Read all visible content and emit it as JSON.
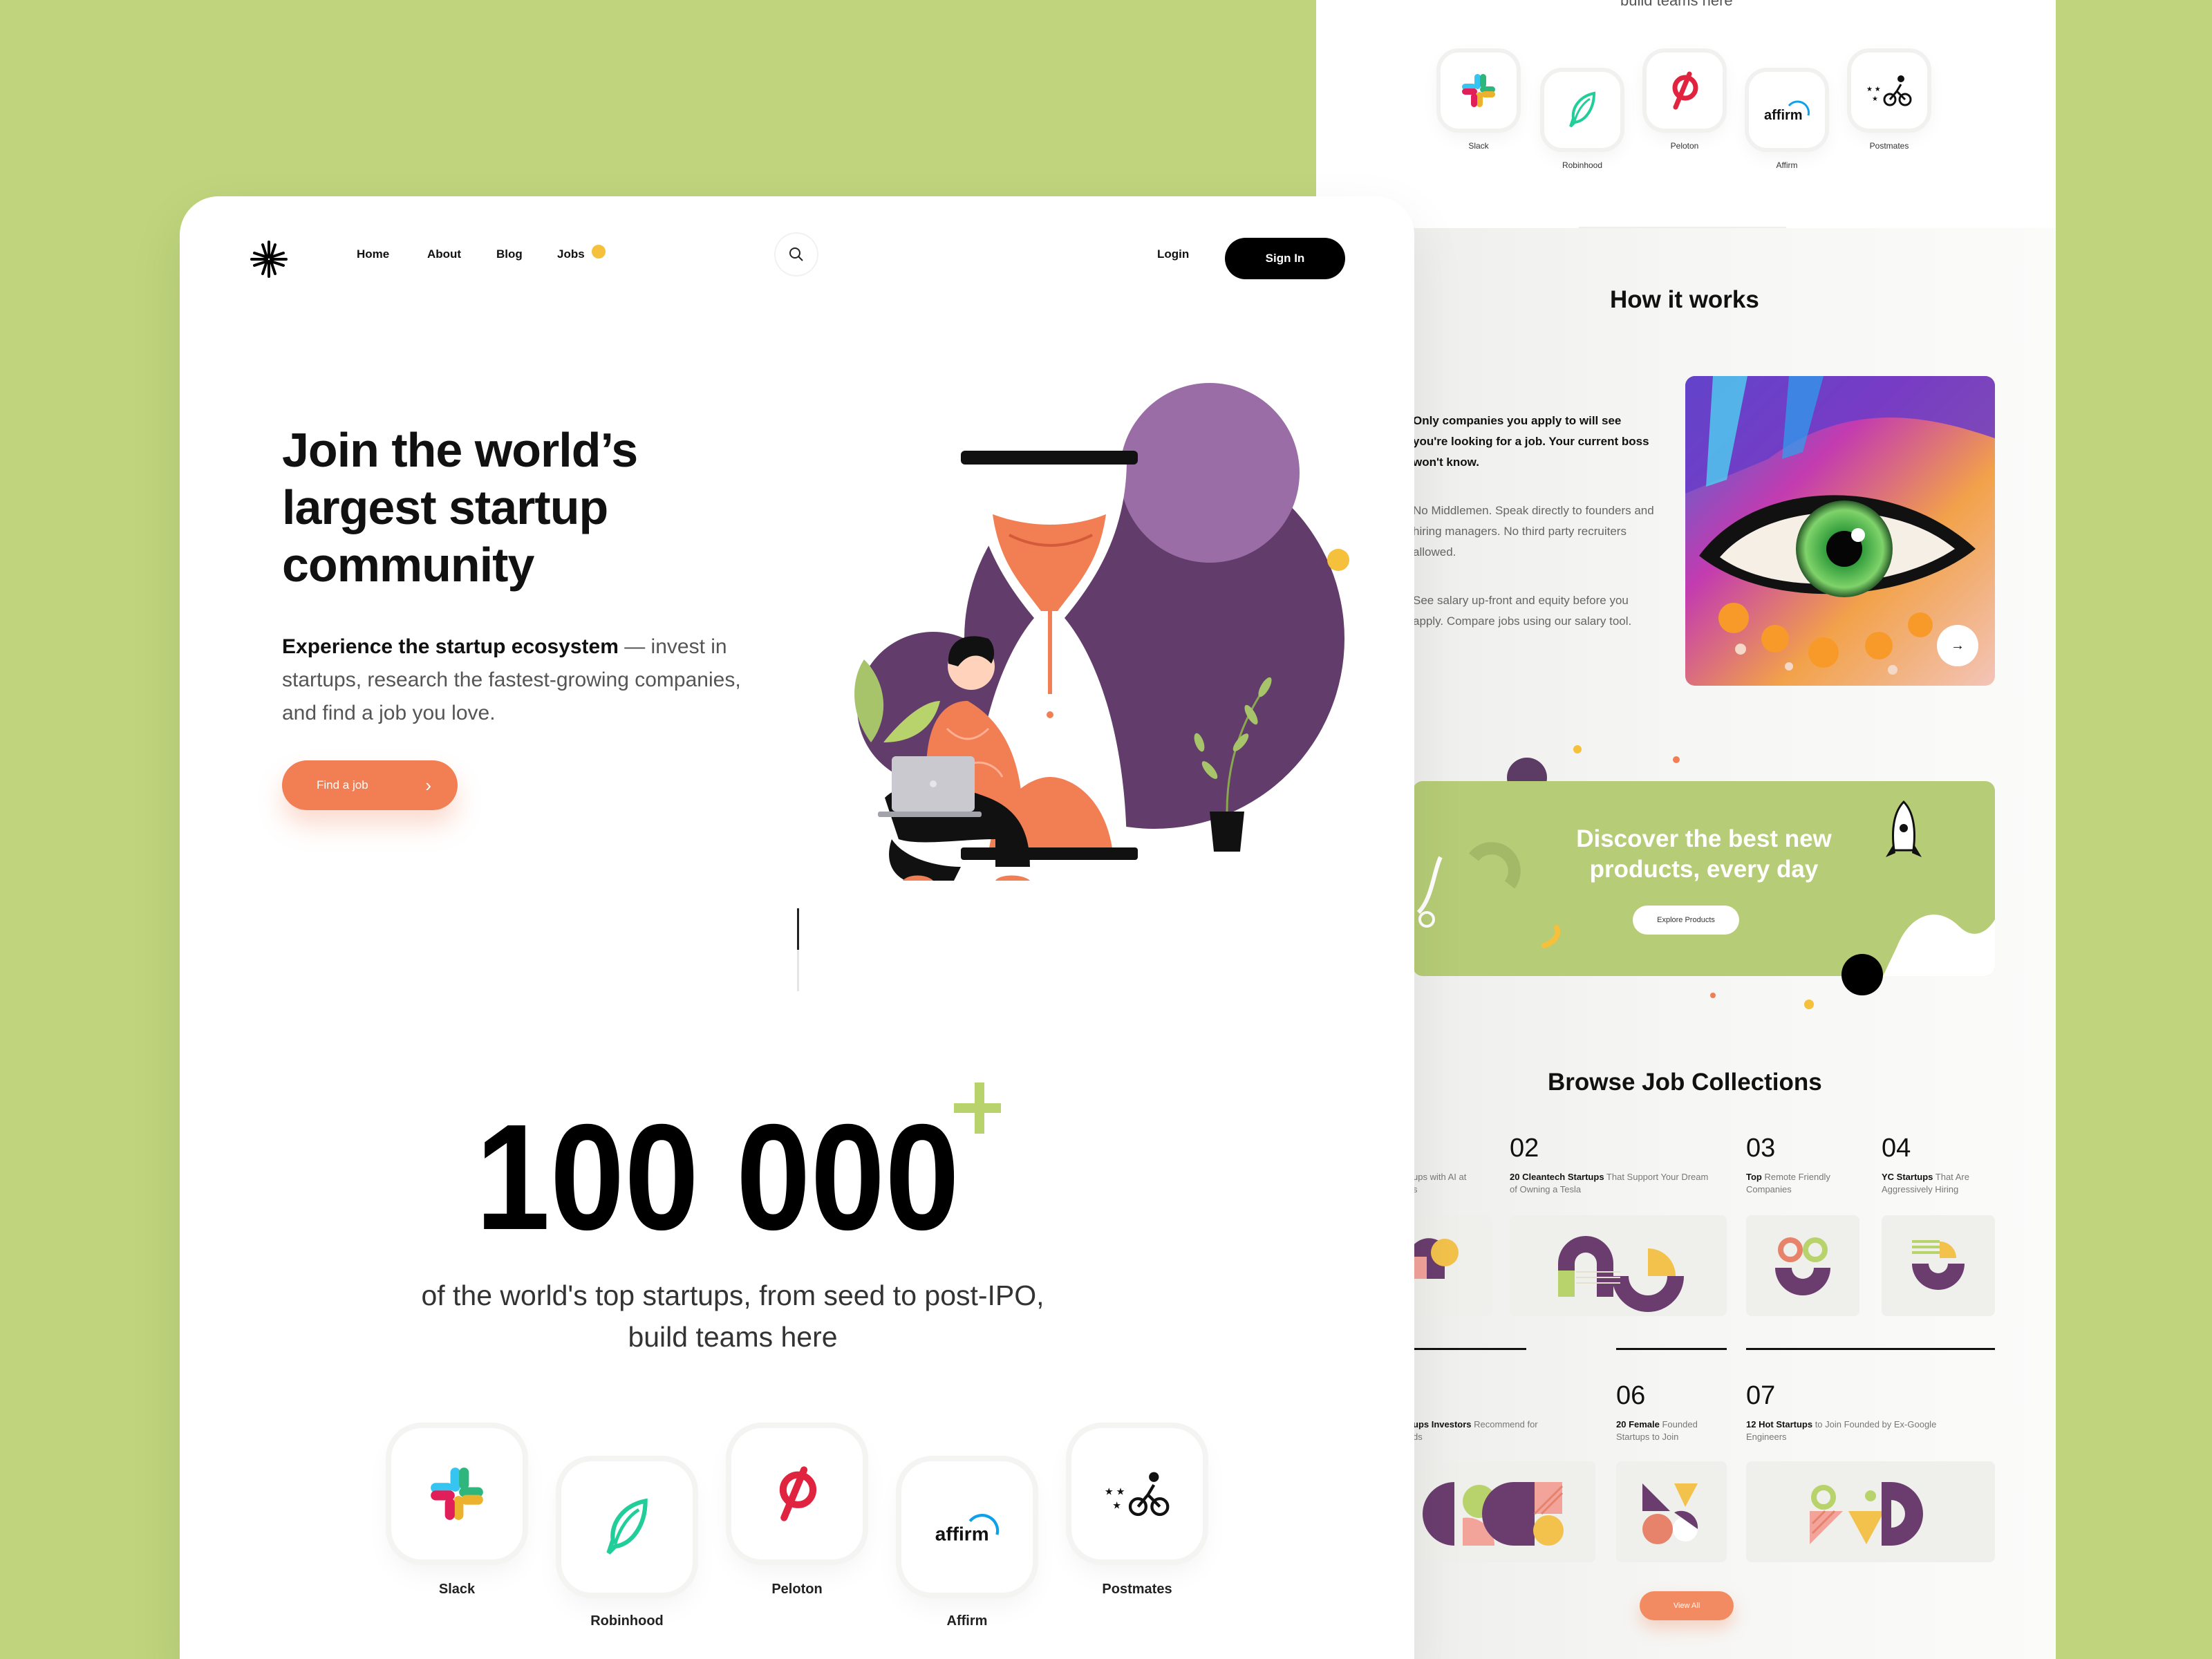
{
  "colors": {
    "background": "#bfd47c",
    "accent": "#f27e54",
    "purple": "#623c6a",
    "light_purple": "#9b6da6",
    "yellow": "#f5c03c",
    "black": "#000000"
  },
  "front": {
    "nav": {
      "logo": "logo-mark",
      "links": [
        "Home",
        "About",
        "Blog",
        "Jobs"
      ],
      "login": "Login",
      "signin": "Sign In"
    },
    "hero": {
      "title_lines": [
        "Join the world’s",
        "largest startup",
        "community"
      ],
      "desc_bold": "Experience the startup ecosystem",
      "desc_rest": " — invest in startups, research the fastest-growing companies, and find a job you love.",
      "cta": "Find a job"
    },
    "stats": {
      "number": "100 000",
      "plus": "+",
      "caption_line1": "of the world's top startups, from seed to post-IPO,",
      "caption_line2": "build teams here"
    },
    "companies": [
      {
        "name": "Slack",
        "icon": "slack-icon"
      },
      {
        "name": "Robinhood",
        "icon": "robinhood-icon"
      },
      {
        "name": "Peloton",
        "icon": "peloton-icon"
      },
      {
        "name": "Affirm",
        "icon": "affirm-icon"
      },
      {
        "name": "Postmates",
        "icon": "postmates-icon"
      }
    ]
  },
  "back": {
    "top_caption": "build teams here",
    "companies": [
      "Slack",
      "Robinhood",
      "Peloton",
      "Affirm",
      "Postmates"
    ],
    "how_it_works": {
      "title": "How it works",
      "bold": "Only companies you apply to will see you're looking for a job. Your current boss won't know.",
      "p1": "No Middlemen. Speak directly to founders and hiring managers. No third party recruiters allowed.",
      "p2": "See salary up-front and equity before you apply. Compare jobs using our salary tool."
    },
    "banner": {
      "title_line1": "Discover the best new",
      "title_line2": "products, every day",
      "button": "Explore Products"
    },
    "collections": {
      "title": "Browse Job Collections",
      "items": [
        {
          "num": "",
          "bold": "",
          "text": "ups with AI at\ns"
        },
        {
          "num": "02",
          "bold": "20 Cleantech Startups",
          "text": " That Support Your Dream of Owning a Tesla"
        },
        {
          "num": "03",
          "bold": "Top",
          "text": " Remote Friendly Companies"
        },
        {
          "num": "04",
          "bold": "YC Startups",
          "text": " That Are Aggressively Hiring"
        },
        {
          "num": "",
          "bold": "ups Investors",
          "text": " Recommend for\nds"
        },
        {
          "num": "06",
          "bold": "20 Female",
          "text": " Founded Startups to Join"
        },
        {
          "num": "07",
          "bold": "12 Hot Startups",
          "text": " to Join Founded by Ex-Google Engineers"
        }
      ],
      "view_all": "View All"
    }
  }
}
